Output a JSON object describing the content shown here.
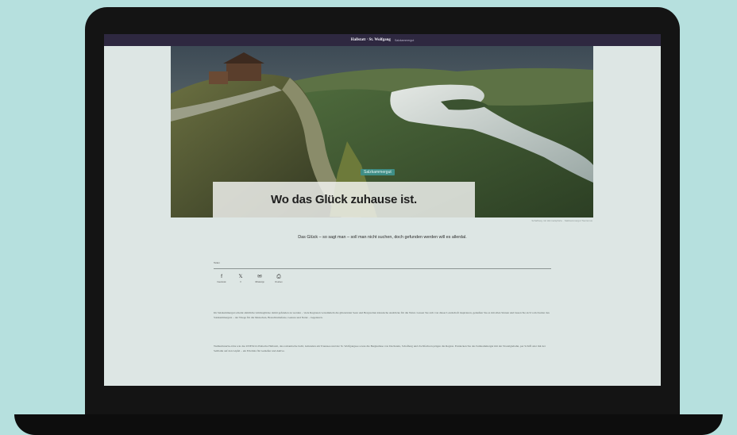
{
  "topbar": {
    "brand": "Hallstatt · St. Wolfgang",
    "subtitle": "Salzkammergut"
  },
  "hero": {
    "tag": "Salzkammergut",
    "title": "Wo das Glück zuhause ist.",
    "caption": "Schafberg mit Himmelspforte · Salzkammergut Tourismus"
  },
  "lead": "Das Glück – so sagt man – soll man nicht suchen, doch gefunden werden will es allerdal.",
  "share": {
    "label": "Teilen",
    "items": [
      {
        "icon": "f",
        "label": "Facebook"
      },
      {
        "icon": "𝕏",
        "label": "X"
      },
      {
        "icon": "✉",
        "label": "WhatsApp"
      },
      {
        "icon": "⎙",
        "label": "Drucken"
      }
    ]
  },
  "body": {
    "p1": "Im Salzkammergut scheint sämtliche Glücksglücke damit gefunden zu werden – viele Regionen versammeln die glitzernden Seen und Bergwelten klassische Ausblicke für die Natur. Lassen Sie sich von dieser Landschaft inspirieren, genießen Sie es mit allen Sinnen und lassen Sie sich vom Zauber des Salzkammerguts – der Wiege für die Menschen, Brauchtumsfeste, Genuss und Natur – begeistern.",
    "p2": "Weltkulturerbe-Orte wie das UNESCO-Welterbe Hallstatt, das romantische Ischl, Gmunden am Traunsee und der St. Wolfgangsee sowie die Bergkulisse von Dachstein, Schafberg und Zwölferhorn prägen die Region. Entdecken Sie das Salzkammergut mit der Nostalgiebahn, per Schiff oder mit der Seilbahn auf den Gipfel – ein Erlebnis für Genießer und Aktive."
  }
}
